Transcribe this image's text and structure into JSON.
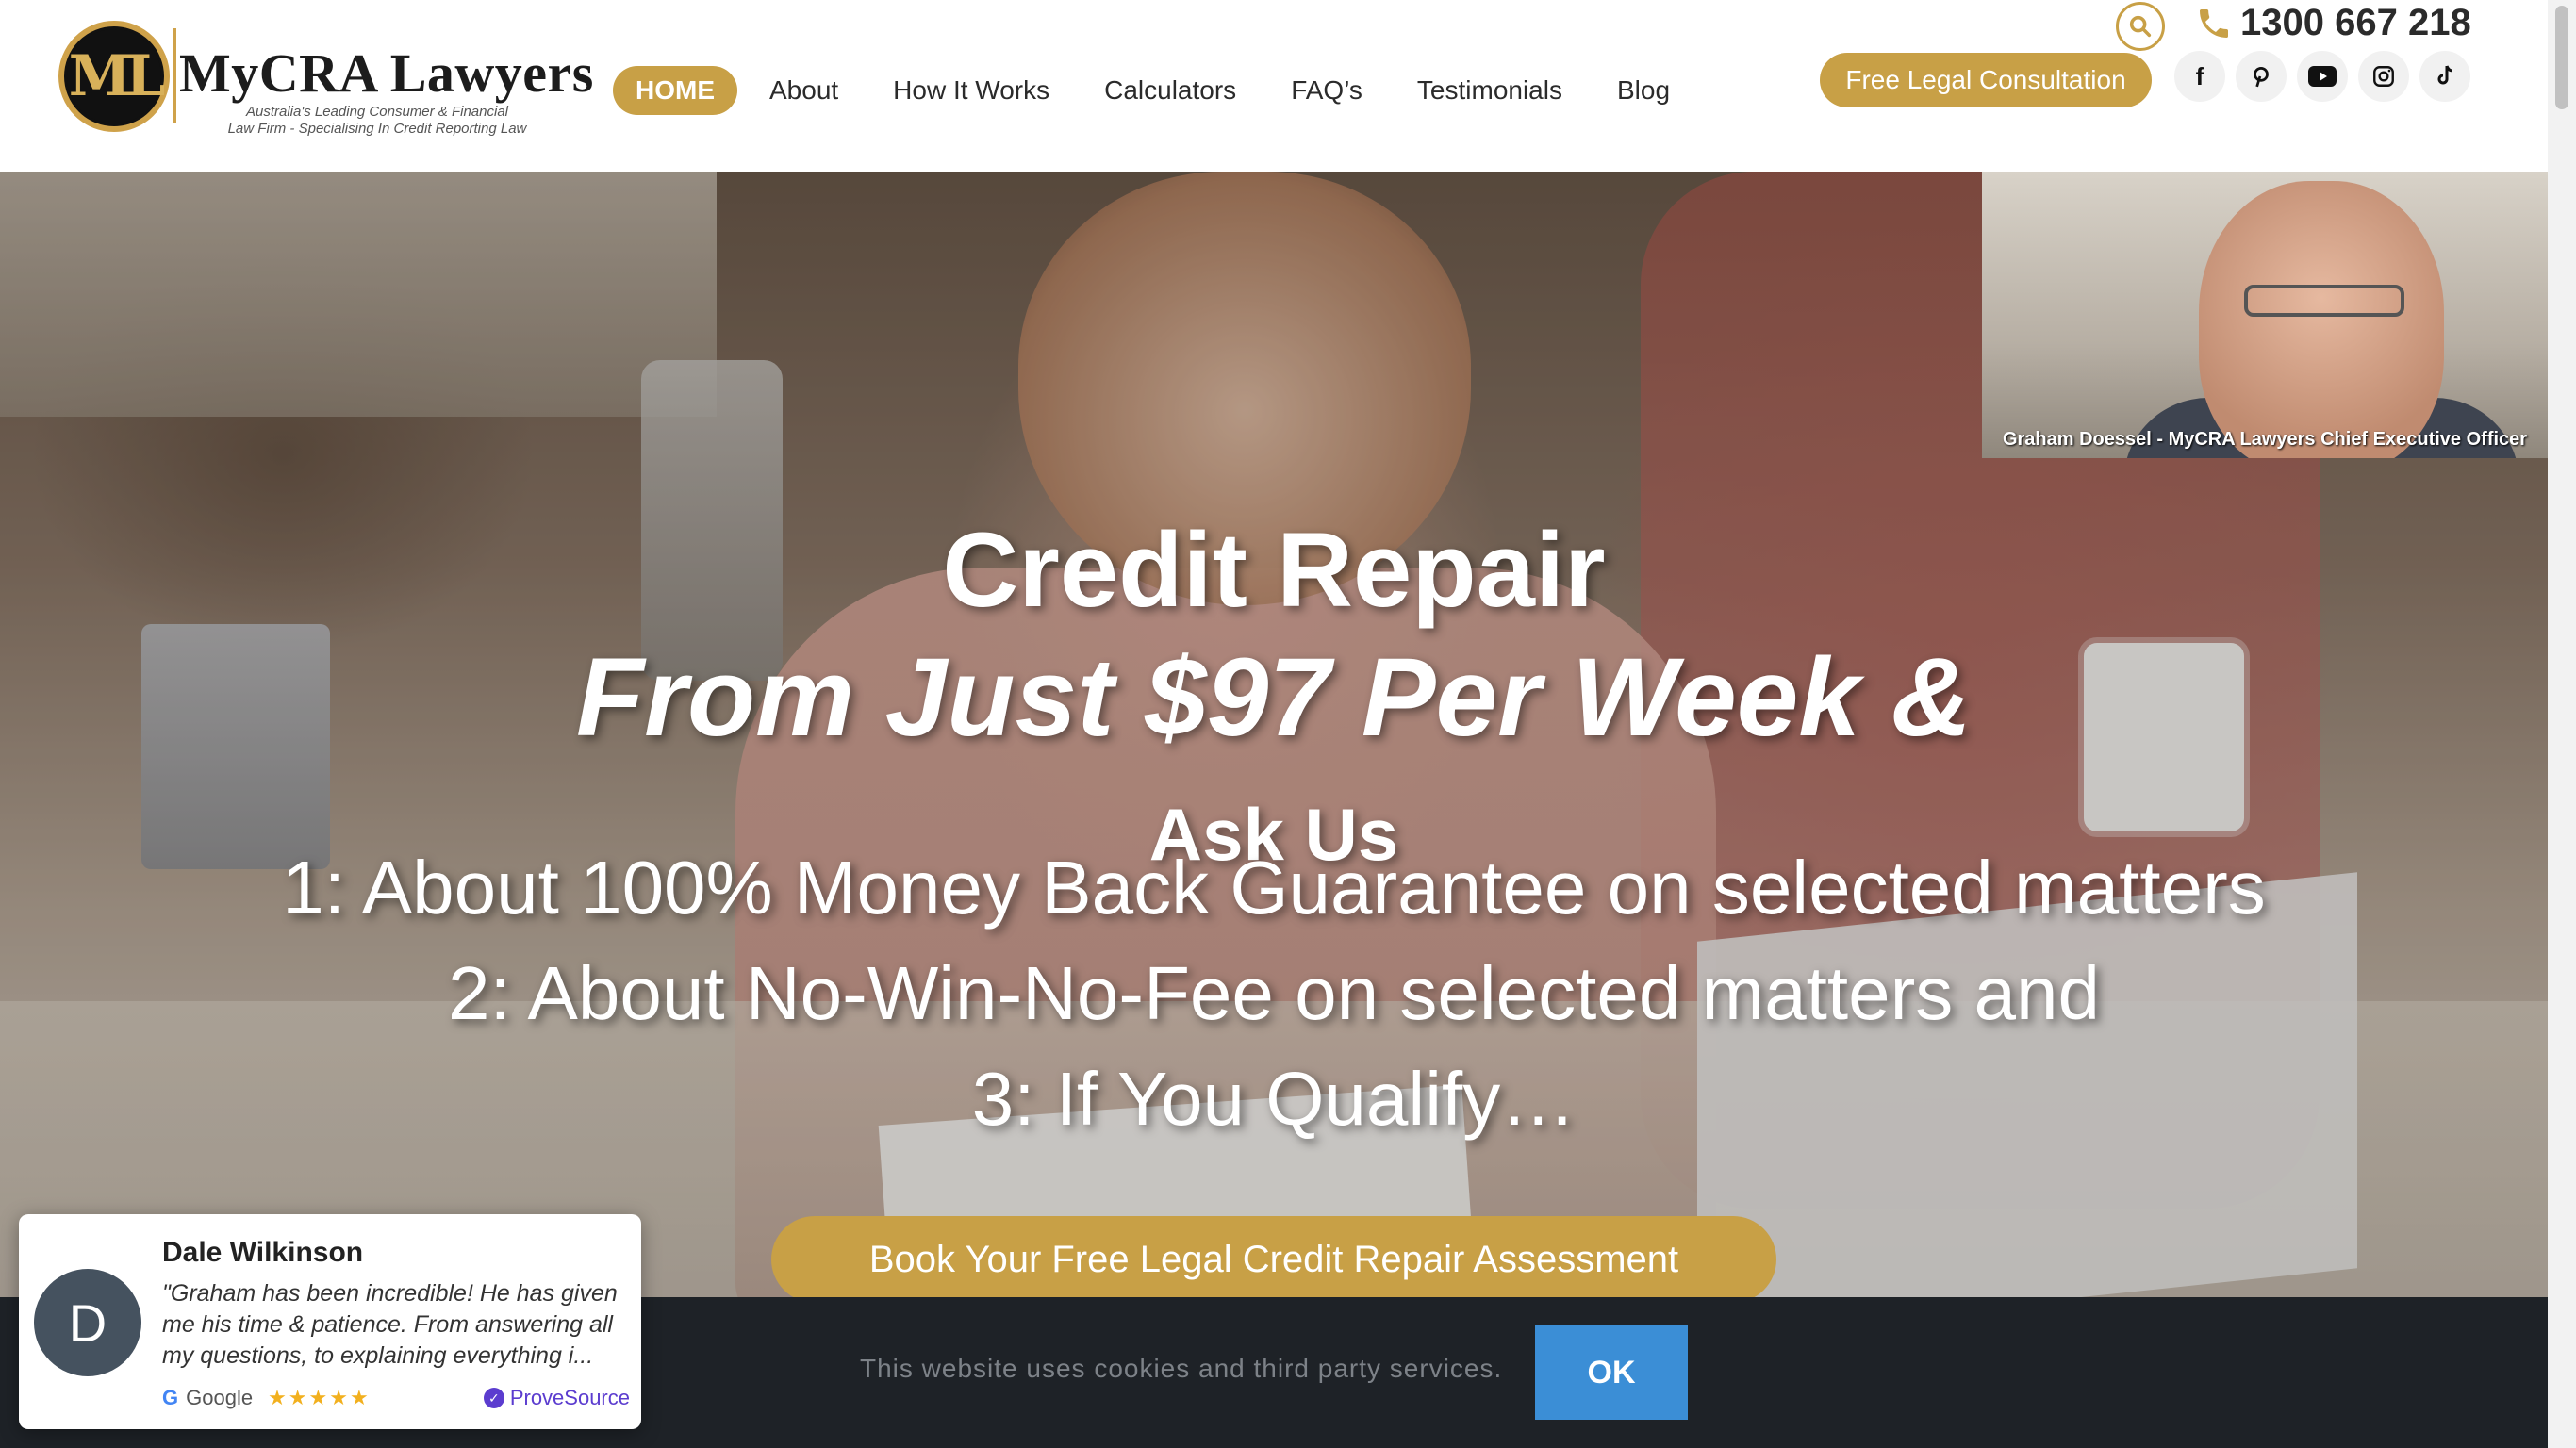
{
  "header": {
    "logo_mono": "ML",
    "logo_title": "MyCRA Lawyers",
    "logo_tagline_1": "Australia's Leading Consumer & Financial",
    "logo_tagline_2": "Law Firm - Specialising In Credit Reporting Law",
    "nav": [
      {
        "label": "HOME",
        "active": true
      },
      {
        "label": "About"
      },
      {
        "label": "How It Works"
      },
      {
        "label": "Calculators"
      },
      {
        "label": "FAQ’s"
      },
      {
        "label": "Testimonials"
      },
      {
        "label": "Blog"
      }
    ],
    "phone": "1300 667 218",
    "consult_label": "Free Legal Consultation",
    "socials": [
      "facebook-icon",
      "pinterest-icon",
      "youtube-icon",
      "instagram-icon",
      "tiktok-icon"
    ]
  },
  "hero": {
    "title_1": "Credit Repair",
    "title_2": "From Just $97 Per Week &",
    "title_3": "Ask Us",
    "line_1": "1: About 100% Money Back Guarantee on selected matters",
    "line_2": "2: About No-Win-No-Fee on selected matters and",
    "line_3": "3: If You Qualify…",
    "cta_label": "Book Your Free Legal Credit Repair Assessment",
    "video_caption": "Graham Doessel - MyCRA Lawyers Chief Executive Officer"
  },
  "cookie": {
    "text": "This website uses cookies and third party services.",
    "ok_label": "OK"
  },
  "review": {
    "avatar_letter": "D",
    "name": "Dale Wilkinson",
    "text": "\"Graham has been incredible! He has given me his time & patience. From answering all my questions, to explaining everything i...",
    "source": "Google",
    "stars": "★★★★★",
    "verified_by": "ProveSource"
  },
  "colors": {
    "accent": "#c8a046",
    "cookie_bg": "#1e2227",
    "ok_button": "#3b8ed6"
  }
}
